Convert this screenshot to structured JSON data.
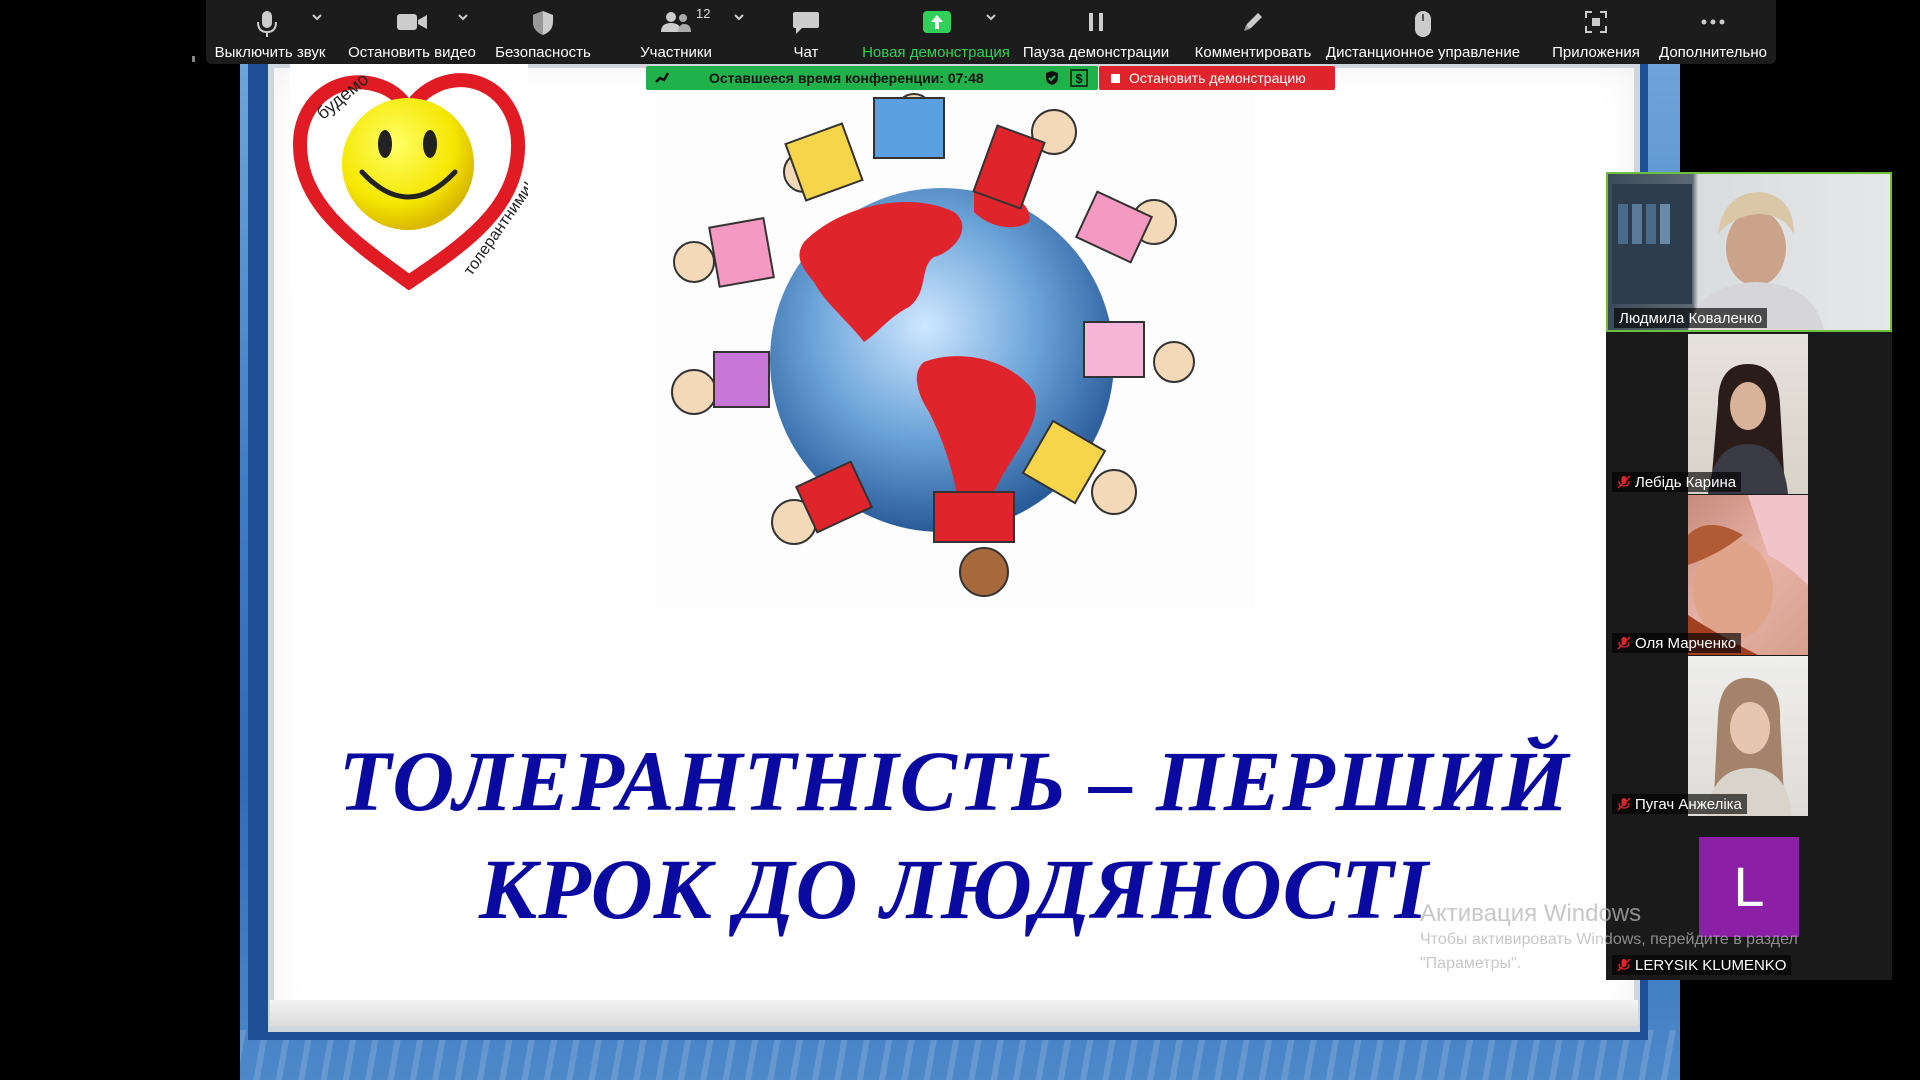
{
  "toolbar": {
    "mute_label": "Выключить звук",
    "stop_video_label": "Остановить видео",
    "security_label": "Безопасность",
    "participants_label": "Участники",
    "participants_count": "12",
    "chat_label": "Чат",
    "new_share_label": "Новая демонстрация",
    "pause_share_label": "Пауза демонстрации",
    "annotate_label": "Комментировать",
    "remote_control_label": "Дистанционное управление",
    "apps_label": "Приложения",
    "more_label": "Дополнительно",
    "accent_green": "#30d158"
  },
  "banner": {
    "time_text": "Оставшееся время конференции: 07:48",
    "stop_share_label": "Остановить демонстрацию",
    "banner_color": "#21b14a",
    "stop_color": "#e0242c"
  },
  "slide": {
    "logo_text_top": "будемо",
    "logo_text_bottom": "толерантними!",
    "title_line1": "ТОЛЕРАНТНІСТЬ – ПЕРШИЙ",
    "title_line2": "КРОК ДО ЛЮДЯНОСТІ",
    "title_color": "#0a0aa0"
  },
  "participants": [
    {
      "name": "Людмила Коваленко",
      "muted": false,
      "active": true
    },
    {
      "name": "Лебідь Карина",
      "muted": true
    },
    {
      "name": "Оля Марченко",
      "muted": true
    },
    {
      "name": "Пугач Анжеліка",
      "muted": true
    },
    {
      "name": "LERYSIK KLUMENKO",
      "muted": true,
      "avatar_letter": "L",
      "avatar_color": "#8b1fa6"
    }
  ],
  "watermark": {
    "title": "Активация Windows",
    "subtitle": "Чтобы активировать Windows, перейдите в раздел \"Параметры\"."
  }
}
